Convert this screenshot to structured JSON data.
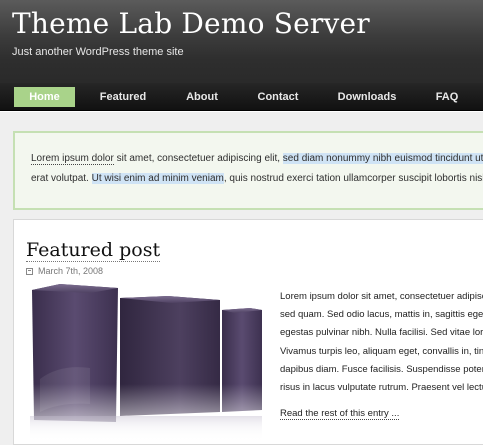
{
  "header": {
    "site_title": "Theme Lab Demo Server",
    "tagline": "Just another WordPress theme site"
  },
  "nav": {
    "items": [
      {
        "label": "Home",
        "active": true
      },
      {
        "label": "Featured"
      },
      {
        "label": "About"
      },
      {
        "label": "Contact"
      },
      {
        "label": "Downloads"
      },
      {
        "label": "FAQ"
      }
    ]
  },
  "notice": {
    "line1": {
      "link1": "Lorem ipsum dolor",
      "text1": " sit amet, consectetuer adipiscing elit, ",
      "highlight1": "sed diam nonummy nibh euismod tincidunt ut laoreet dolore magna aliquam"
    },
    "line2": {
      "text1": "erat volutpat. ",
      "highlight1": "Ut wisi enim ad minim veniam",
      "text2": ", quis nostrud exerci tation ullamcorper suscipit lobortis nisl ut aliquip"
    }
  },
  "post": {
    "title": "Featured post",
    "date": "March 7th, 2008",
    "image_icon": "product-boxes-image",
    "body_lines": [
      "Lorem ipsum dolor sit amet, consectetuer adipiscing",
      "sed quam. Sed odio lacus, mattis in, sagittis eget",
      "egestas pulvinar nibh. Nulla facilisi. Sed vitae lorem",
      "Vivamus turpis leo, aliquam eget, convallis in, tincidunt",
      "dapibus diam. Fusce facilisis. Suspendisse potenti",
      "risus in lacus vulputate rutrum. Praesent vel lectus"
    ],
    "read_more": "Read the rest of this entry ..."
  },
  "colors": {
    "nav_active": "#a9d38a",
    "notice_border": "#c5e0b3",
    "highlight": "#cfe3f5",
    "box_purple": "#4a3d5e"
  }
}
